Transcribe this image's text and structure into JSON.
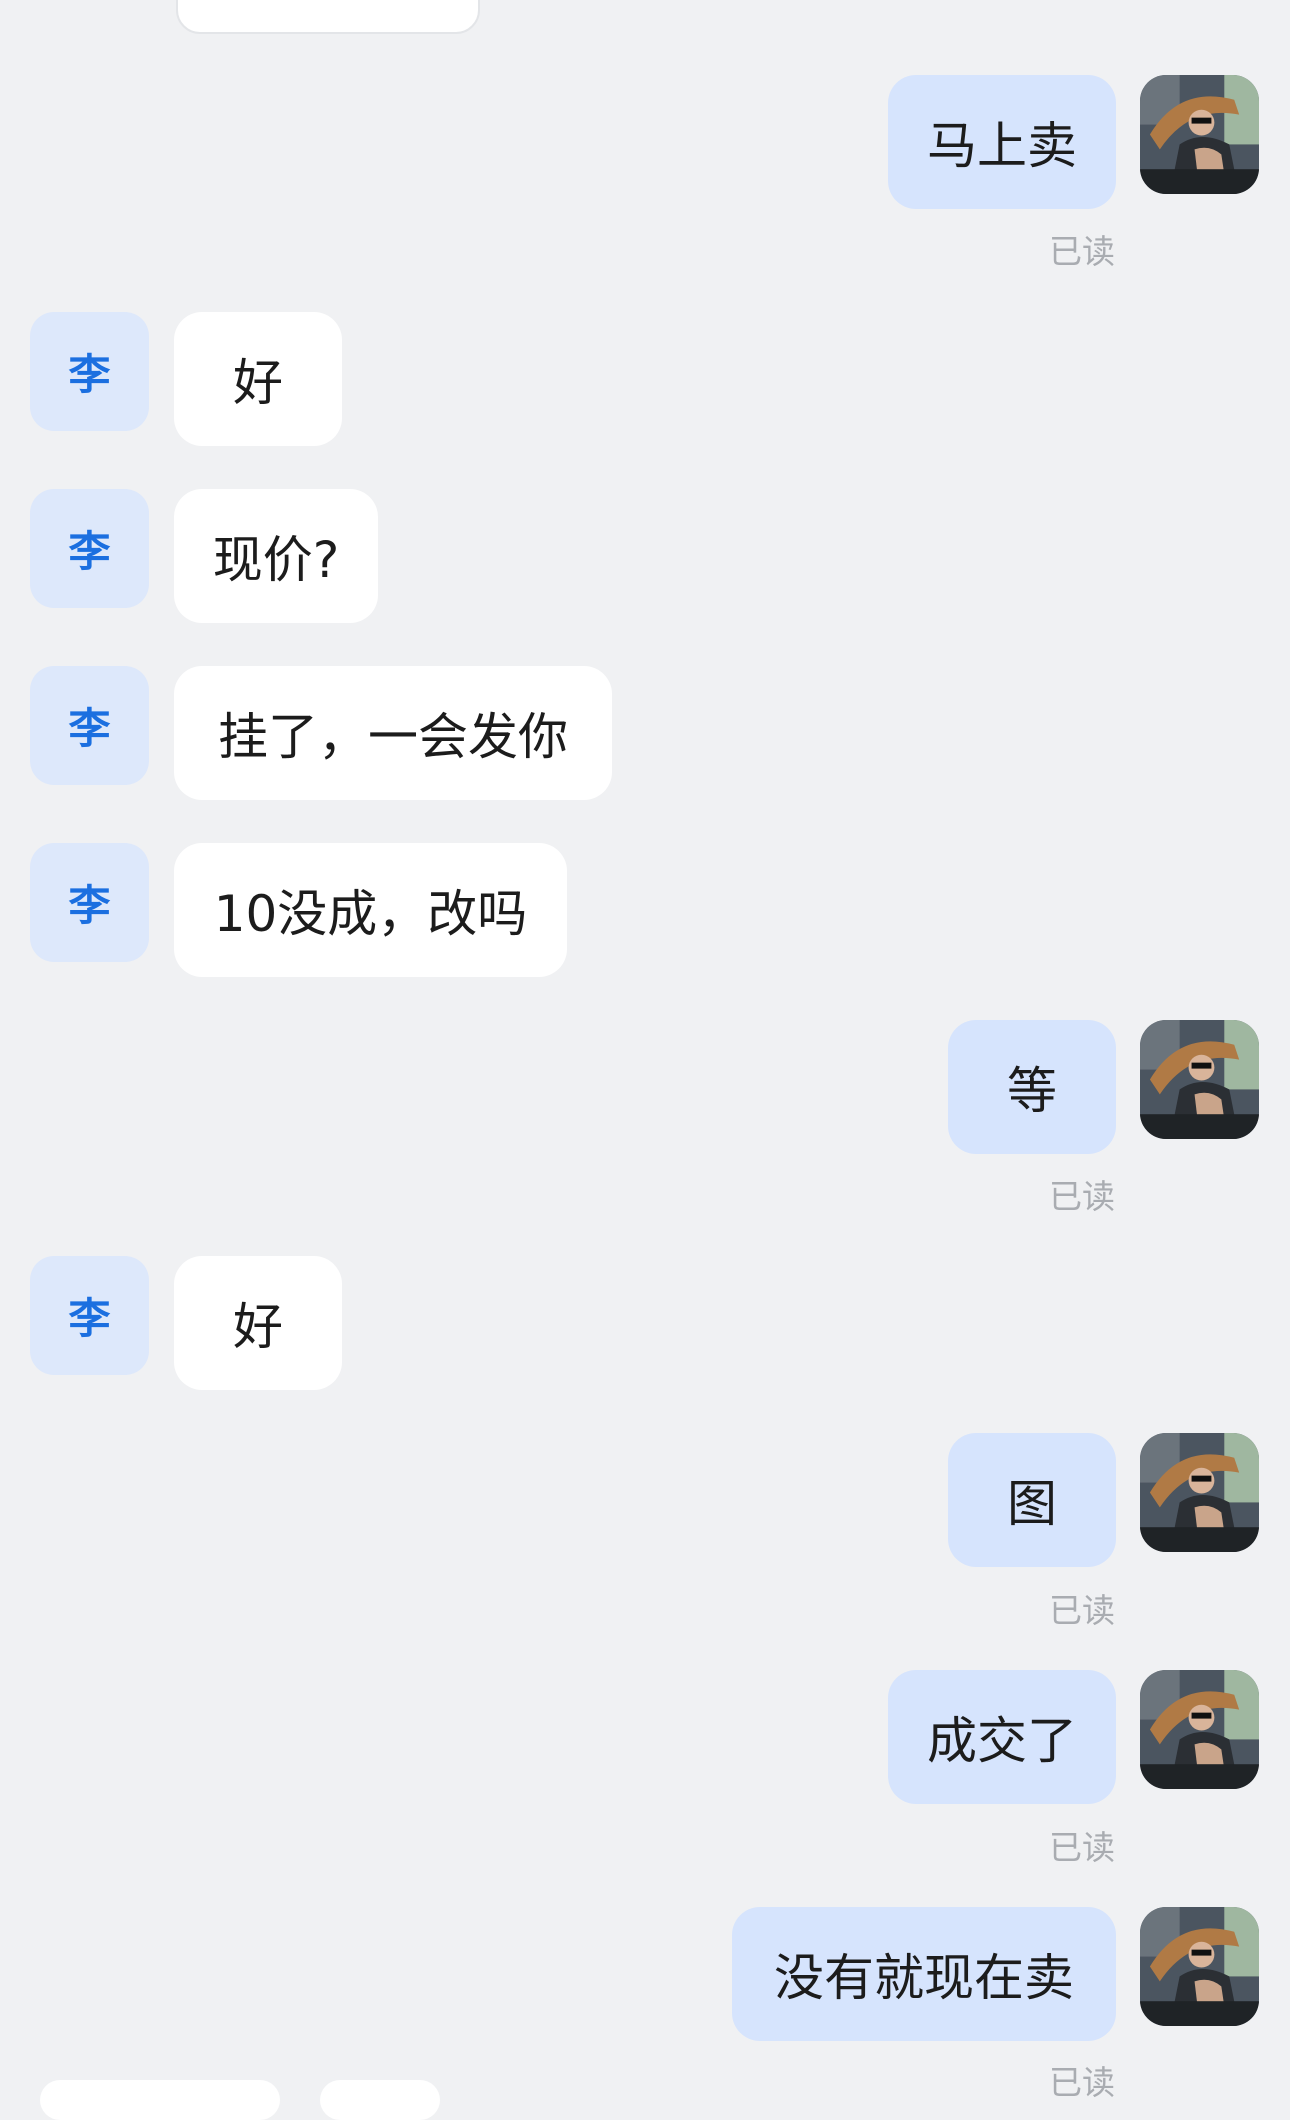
{
  "contacts": {
    "other_avatar_text": "李"
  },
  "messages": [
    {
      "side": "out",
      "text": "马上卖",
      "status": "已读"
    },
    {
      "side": "in",
      "text": "好"
    },
    {
      "side": "in",
      "text": "现价?"
    },
    {
      "side": "in",
      "text": "挂了，一会发你"
    },
    {
      "side": "in",
      "text": "10没成，改吗"
    },
    {
      "side": "out",
      "text": "等",
      "status": "已读"
    },
    {
      "side": "in",
      "text": "好"
    },
    {
      "side": "out",
      "text": "图",
      "status": "已读"
    },
    {
      "side": "out",
      "text": "成交了",
      "status": "已读"
    },
    {
      "side": "out",
      "text": "没有就现在卖",
      "status": "已读"
    }
  ],
  "colors": {
    "background": "#f0f1f3",
    "incoming_bubble": "#ffffff",
    "outgoing_bubble": "#d6e4fd",
    "avatar_text": "#1b6fe0",
    "avatar_bg": "#dde8fb",
    "read_status": "#a9acb1"
  },
  "icons": {
    "self_avatar": "driver-photo-avatar"
  }
}
